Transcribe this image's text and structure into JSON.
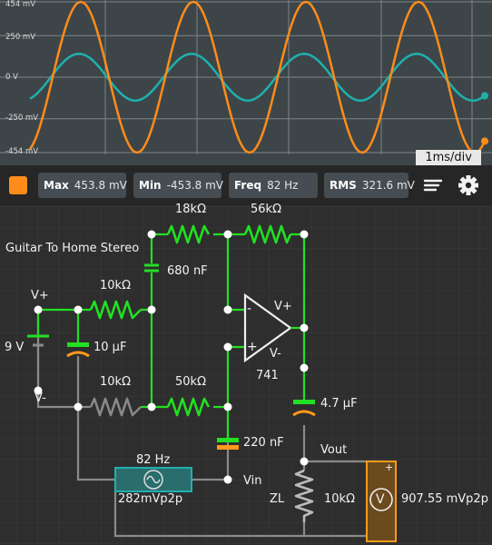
{
  "scope": {
    "y_labels": [
      "454 mV",
      "250 mV",
      "0 V",
      "-250 mV",
      "-454 mV"
    ],
    "time_div": "1ms/div",
    "series": [
      {
        "color": "#ff8c1a",
        "amplitude_mv": 453.8
      },
      {
        "color": "#1fb0ae",
        "amplitude_mv": 141
      }
    ],
    "frequency_hz": 82
  },
  "toolbar": {
    "trace_color": "#ff8c1a",
    "max_label": "Max",
    "max_value": "453.8 mV",
    "min_label": "Min",
    "min_value": "-453.8 mV",
    "freq_label": "Freq",
    "freq_value": "82 Hz",
    "rms_label": "RMS",
    "rms_value": "321.6 mV",
    "menu_icon": "menu-lines-icon",
    "settings_icon": "gear-icon"
  },
  "circuit": {
    "title": "Guitar To Home Stereo",
    "r_feedback1": "18kΩ",
    "r_feedback2": "56kΩ",
    "cap_680": "680 nF",
    "r_top": "10kΩ",
    "vplus1": "V+",
    "battery": "9 V",
    "cap_10u": "10 µF",
    "vminus1": "V-",
    "r_bottom": "10kΩ",
    "r_50k": "50kΩ",
    "opamp_minus": "-",
    "opamp_plus": "+",
    "opamp_vplus": "V+",
    "opamp_vminus": "V-",
    "opamp_name": "741",
    "cap_47u": "4.7 µF",
    "cap_220": "220 nF",
    "vout": "Vout",
    "source_freq": "82 Hz",
    "source_amp": "282mVp2p",
    "vin": "Vin",
    "zl": "ZL",
    "r_load": "10kΩ",
    "meter_sign": "+",
    "meter_symbol": "V",
    "meter_value": "907.55 mVp2p",
    "colors": {
      "wire_active": "#22e022",
      "wire_idle": "#8a8a8a",
      "node": "#ffffff",
      "cap_orange": "#ff9a1a"
    }
  }
}
